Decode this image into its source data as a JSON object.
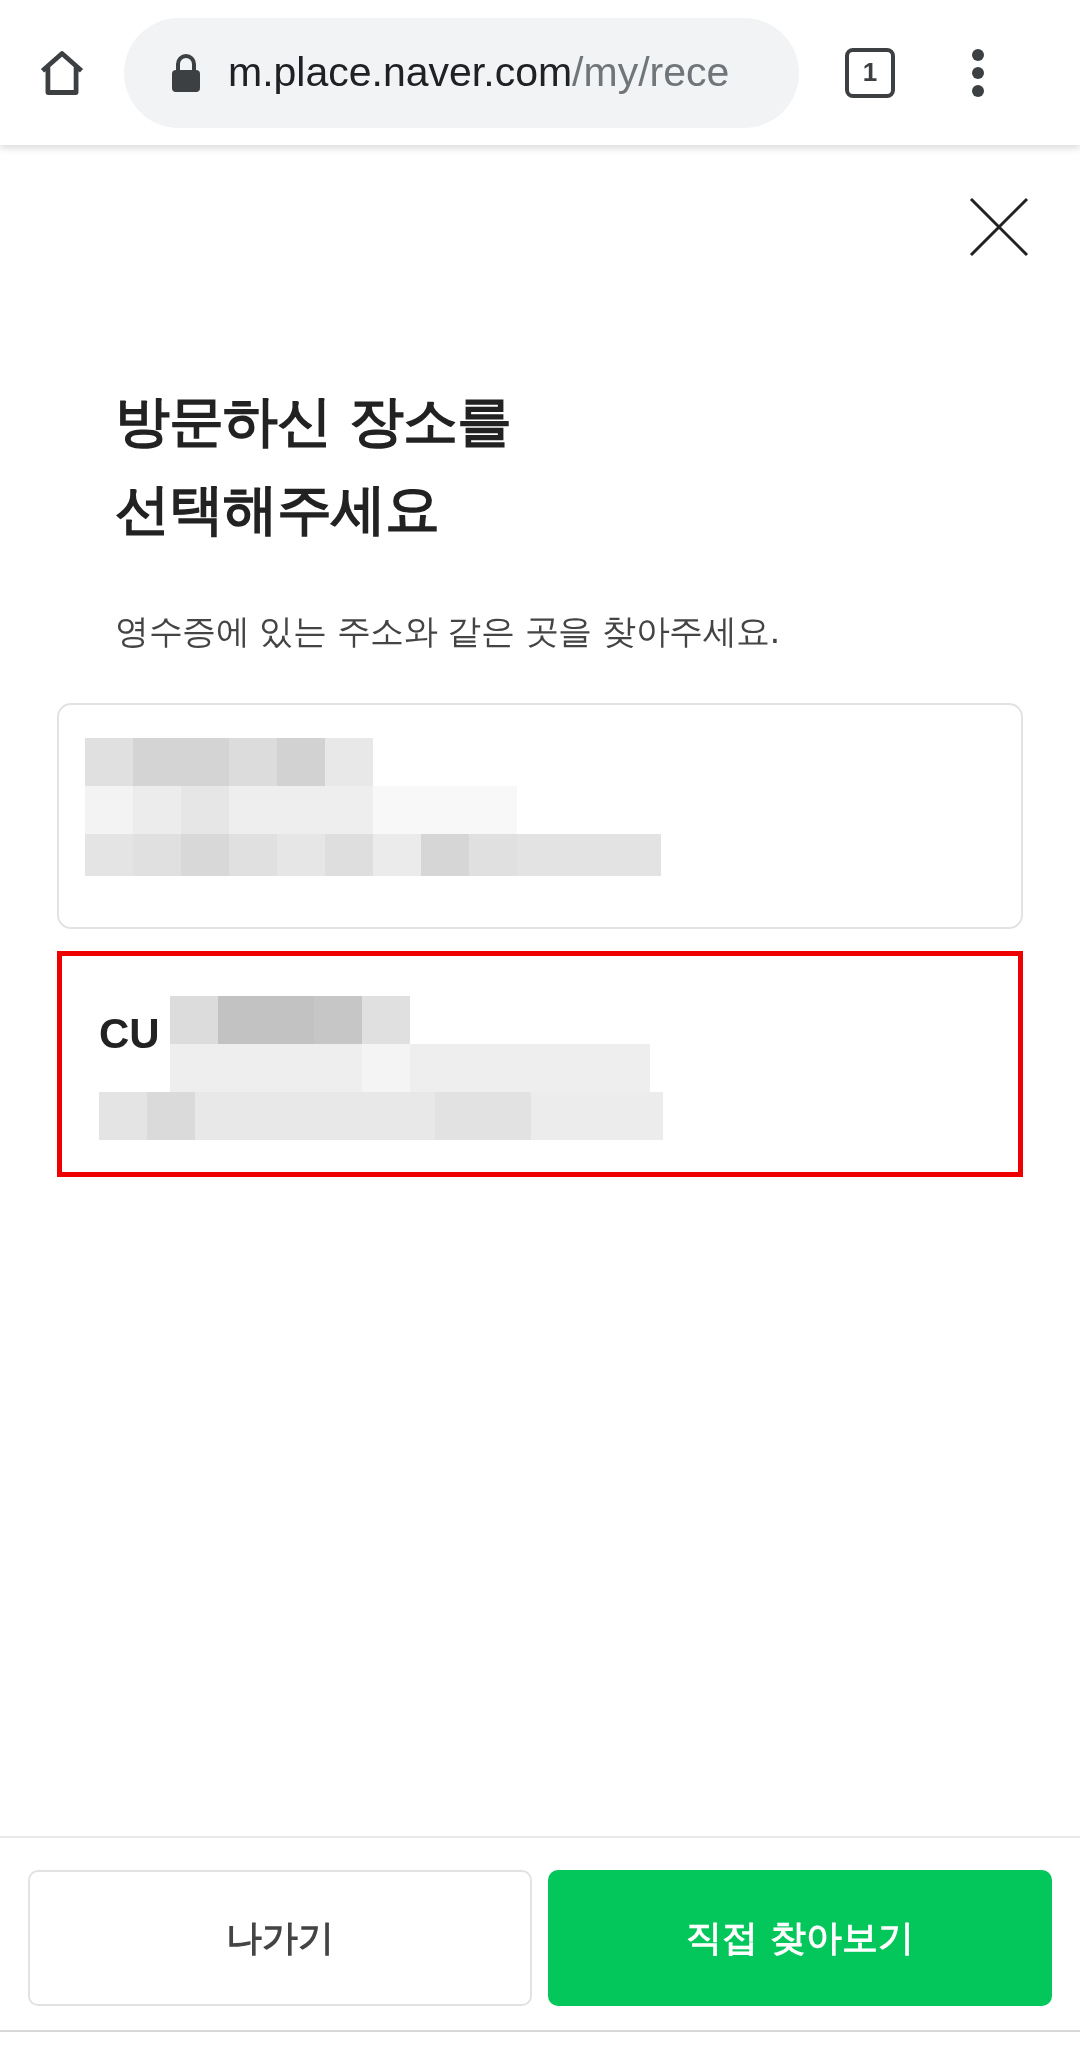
{
  "browser": {
    "url_host": "m.place.naver.com",
    "url_path": "/my/rece",
    "tab_count": "1"
  },
  "title": "방문하신 장소를\n선택해주세요",
  "subtitle": "영수증에 있는 주소와 같은 곳을 찾아주세요.",
  "places": [
    {
      "highlighted": false
    },
    {
      "name": "CU",
      "highlighted": true
    }
  ],
  "buttons": [
    {
      "label": "나가기",
      "kind": "secondary"
    },
    {
      "label": "직접 찾아보기",
      "kind": "primary"
    }
  ]
}
